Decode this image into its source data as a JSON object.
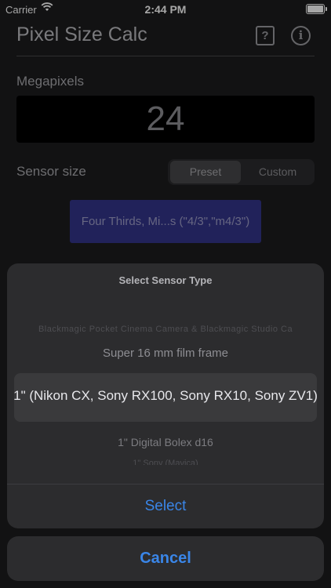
{
  "status_bar": {
    "carrier": "Carrier",
    "time": "2:44 PM"
  },
  "app": {
    "title": "Pixel Size Calc",
    "help_label": "?",
    "info_label": "i"
  },
  "megapixels": {
    "label": "Megapixels",
    "value": "24"
  },
  "sensor_size": {
    "label": "Sensor size",
    "segments": [
      {
        "label": "Preset",
        "selected": true
      },
      {
        "label": "Custom",
        "selected": false
      }
    ],
    "preset_button_label": "Four Thirds, Mi...s (\"4/3\",\"m4/3\")"
  },
  "sheet": {
    "title": "Select Sensor Type",
    "picker_rows": {
      "far_above": "Blackmagic Pocket Cinema Camera & Blackmagic Studio Ca",
      "above": "Super 16 mm film frame",
      "selected": "1\" (Nikon CX, Sony RX100, Sony RX10, Sony ZV1)",
      "below": "1\" Digital Bolex d16",
      "far_below": "1\" Sony (Mavica)"
    },
    "select_label": "Select",
    "cancel_label": "Cancel"
  },
  "colors": {
    "background": "#1c1c1e",
    "sheet": "#2c2c2e",
    "accent": "#3a86e8",
    "preset_button": "#34358a"
  }
}
